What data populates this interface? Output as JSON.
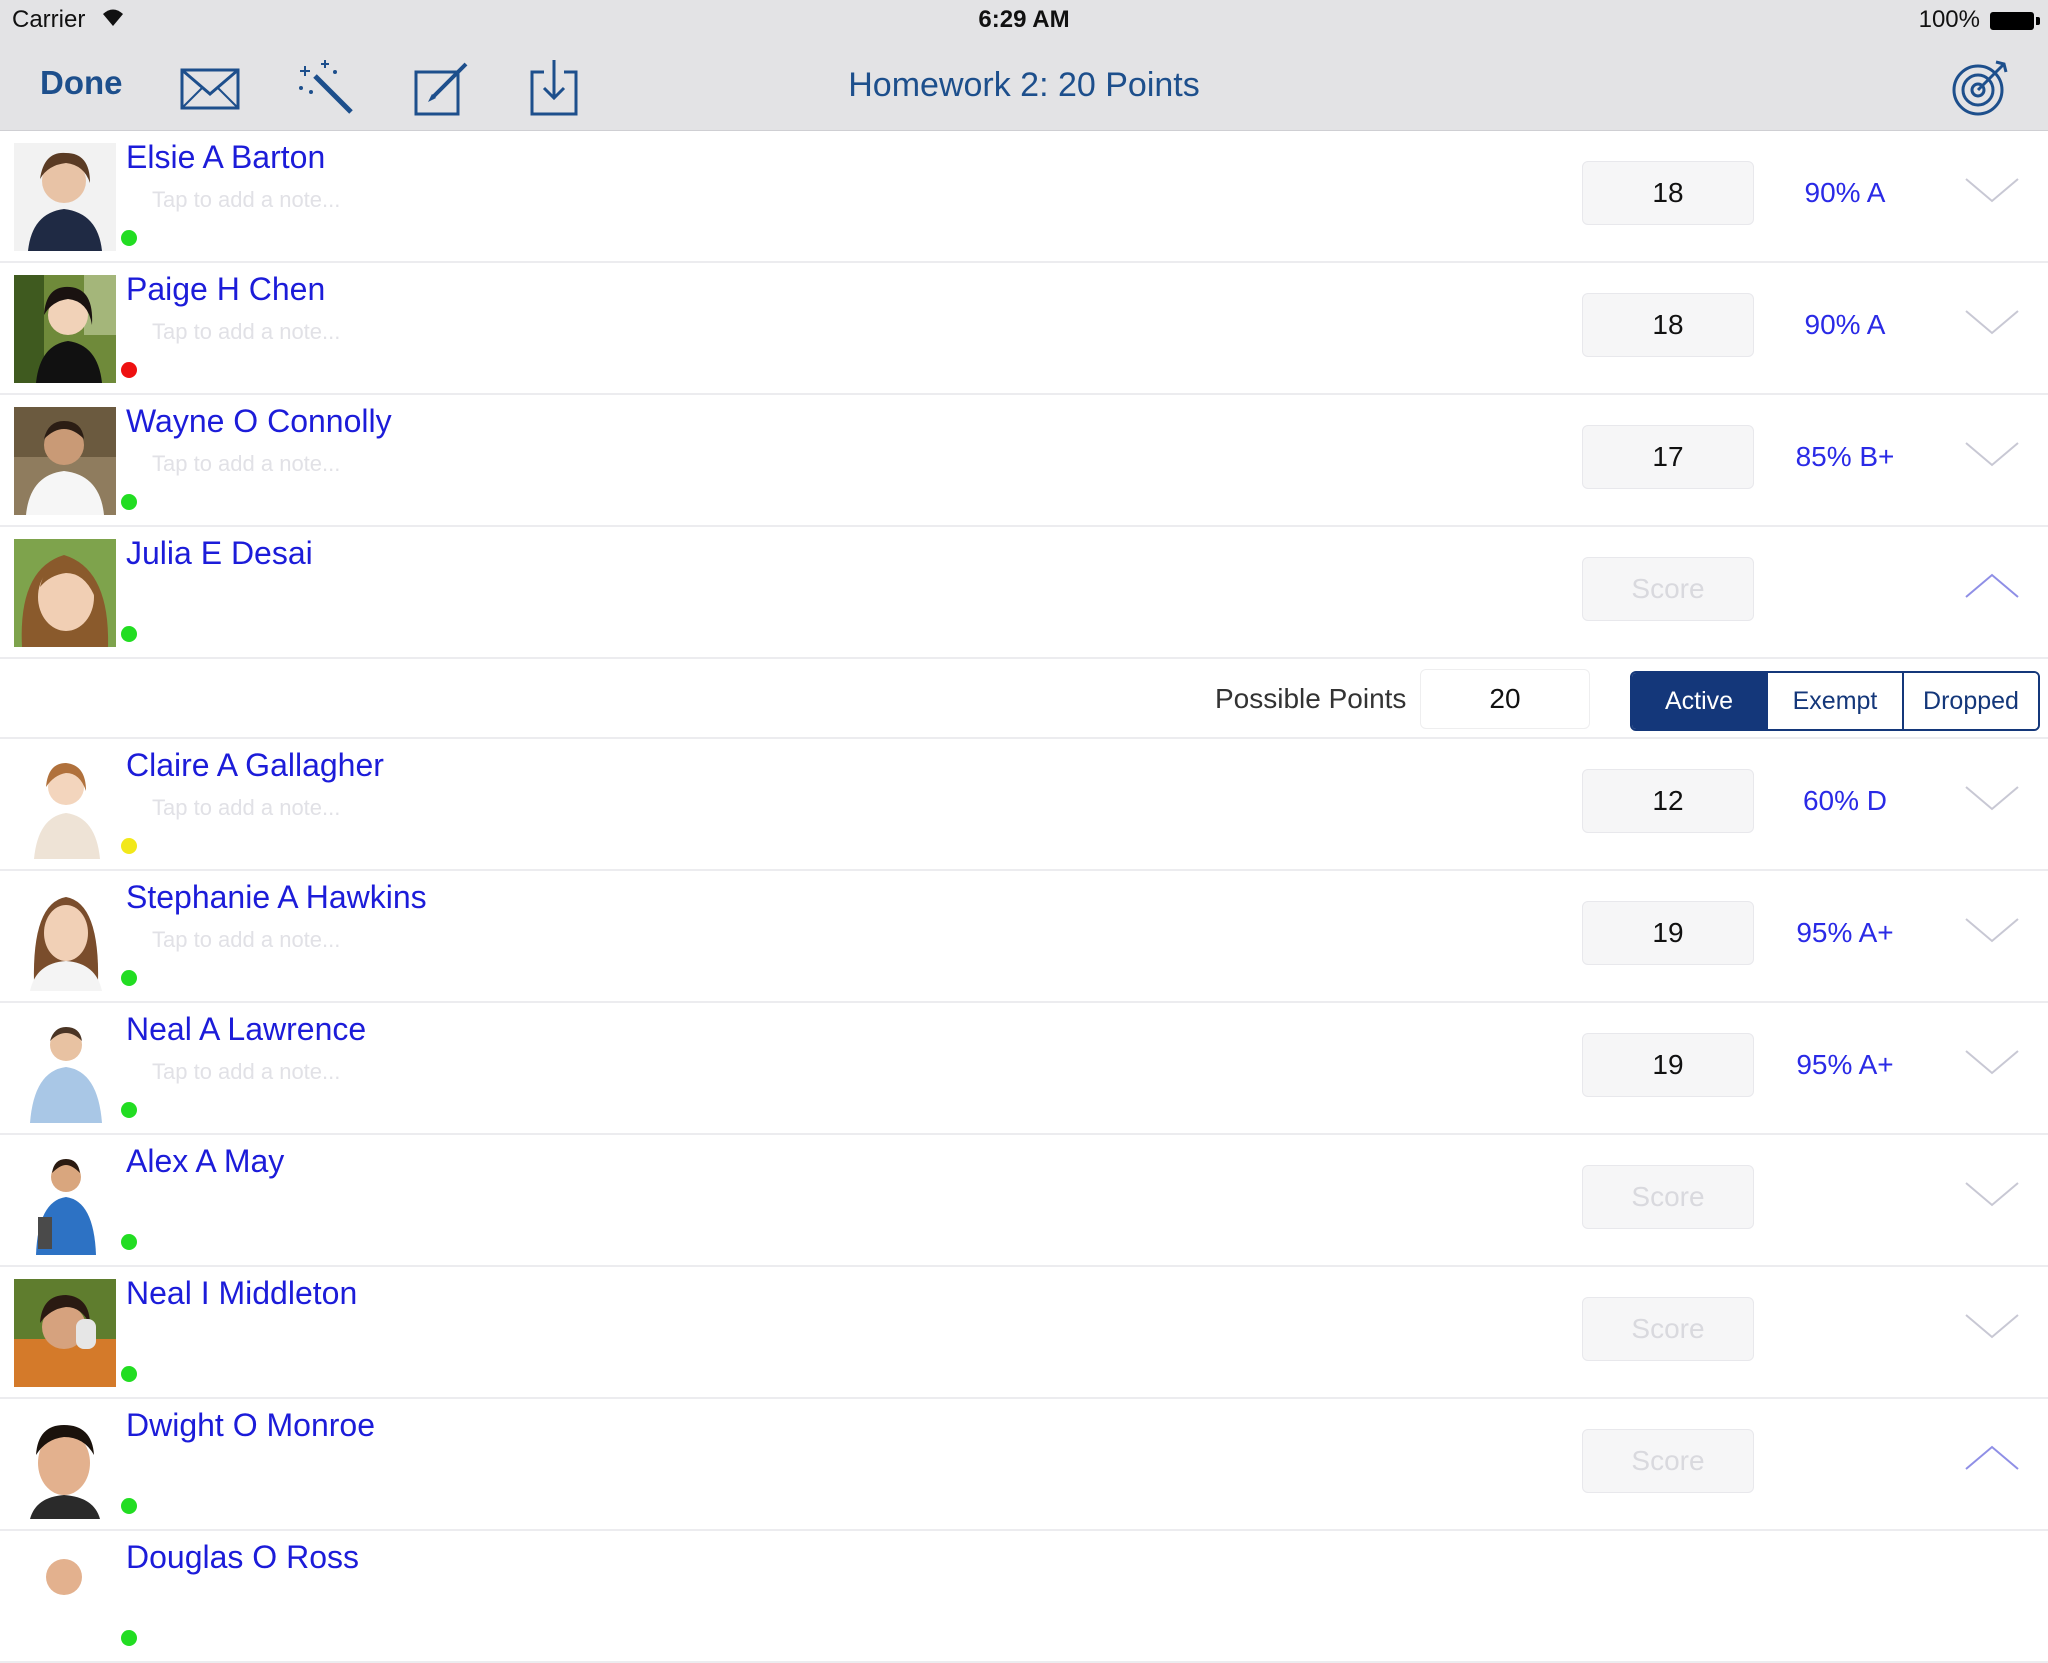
{
  "status_bar": {
    "carrier": "Carrier",
    "time": "6:29 AM",
    "battery": "100%"
  },
  "toolbar": {
    "done_label": "Done",
    "title": "Homework 2: 20 Points",
    "icons": [
      "mail-icon",
      "magic-wand-icon",
      "edit-icon",
      "download-icon",
      "target-icon"
    ]
  },
  "note_placeholder": "Tap to add a note...",
  "score_placeholder": "Score",
  "students": [
    {
      "name": "Elsie A Barton",
      "score": "18",
      "grade": "90% A",
      "status": "#22dd22",
      "expanded": false
    },
    {
      "name": "Paige H Chen",
      "score": "18",
      "grade": "90% A",
      "status": "#ee1111",
      "expanded": false
    },
    {
      "name": "Wayne O Connolly",
      "score": "17",
      "grade": "85% B+",
      "status": "#22dd22",
      "expanded": false
    },
    {
      "name": "Julia E Desai",
      "score": "",
      "grade": "",
      "status": "#22dd22",
      "expanded": true
    },
    {
      "name": "Claire A Gallagher",
      "score": "12",
      "grade": "60% D",
      "status": "#f2e81a",
      "expanded": false
    },
    {
      "name": "Stephanie A Hawkins",
      "score": "19",
      "grade": "95% A+",
      "status": "#22dd22",
      "expanded": false
    },
    {
      "name": "Neal A Lawrence",
      "score": "19",
      "grade": "95% A+",
      "status": "#22dd22",
      "expanded": false
    },
    {
      "name": "Alex A May",
      "score": "",
      "grade": "",
      "status": "#22dd22",
      "expanded": false
    },
    {
      "name": "Neal I Middleton",
      "score": "",
      "grade": "",
      "status": "#22dd22",
      "expanded": false
    },
    {
      "name": "Dwight O Monroe",
      "score": "",
      "grade": "",
      "status": "#22dd22",
      "expanded": true
    },
    {
      "name": "Douglas O Ross",
      "score": "",
      "grade": "",
      "status": "#22dd22",
      "expanded": false
    }
  ],
  "expand_panel": {
    "possible_points_label": "Possible Points",
    "possible_points_value": "20",
    "segments": [
      "Active",
      "Exempt",
      "Dropped"
    ],
    "selected_segment": "Active"
  },
  "colors": {
    "toolbar_bg": "#e3e3e5",
    "accent": "#1d4f8c",
    "name": "#1c1cd9",
    "grade": "#2a2ae6",
    "segment": "#14377a"
  }
}
